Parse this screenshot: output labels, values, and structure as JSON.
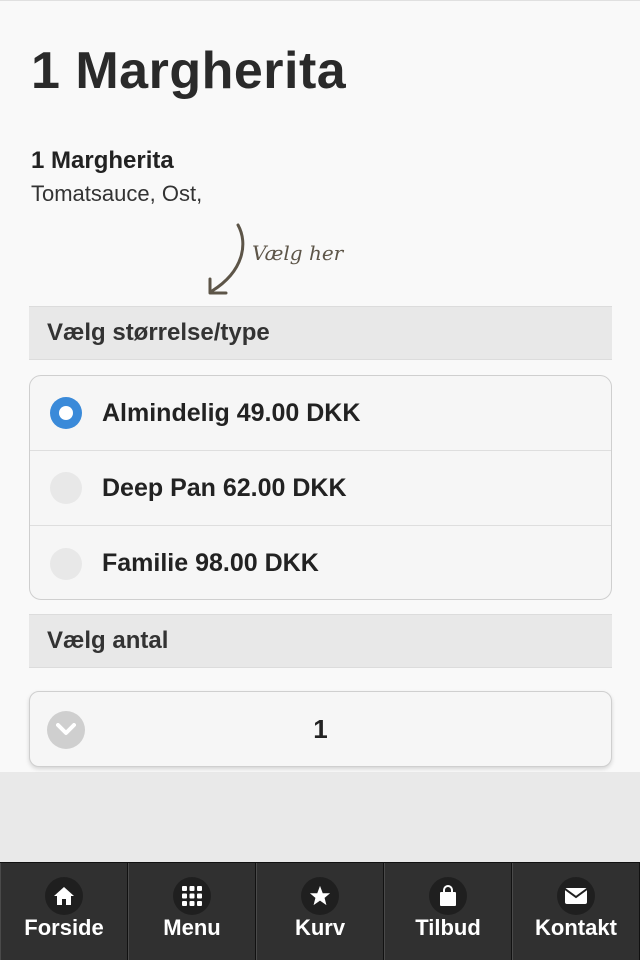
{
  "page": {
    "title": "1 Margherita"
  },
  "product": {
    "name": "1 Margherita",
    "description": "Tomatsauce, Ost,"
  },
  "hint": {
    "text": "Vælg her"
  },
  "size_section": {
    "header": "Vælg størrelse/type",
    "options": [
      {
        "label": "Almindelig 49.00 DKK",
        "selected": true
      },
      {
        "label": "Deep Pan 62.00 DKK",
        "selected": false
      },
      {
        "label": "Familie 98.00 DKK",
        "selected": false
      }
    ]
  },
  "quantity_section": {
    "header": "Vælg antal",
    "value": "1"
  },
  "navbar": {
    "items": [
      {
        "label": "Forside",
        "icon": "home-icon"
      },
      {
        "label": "Menu",
        "icon": "grid-icon"
      },
      {
        "label": "Kurv",
        "icon": "star-icon"
      },
      {
        "label": "Tilbud",
        "icon": "shopping-bag-icon"
      },
      {
        "label": "Kontakt",
        "icon": "mail-icon"
      }
    ]
  },
  "colors": {
    "accent": "#3a8ad9",
    "navbar": "#2b2b2b"
  }
}
